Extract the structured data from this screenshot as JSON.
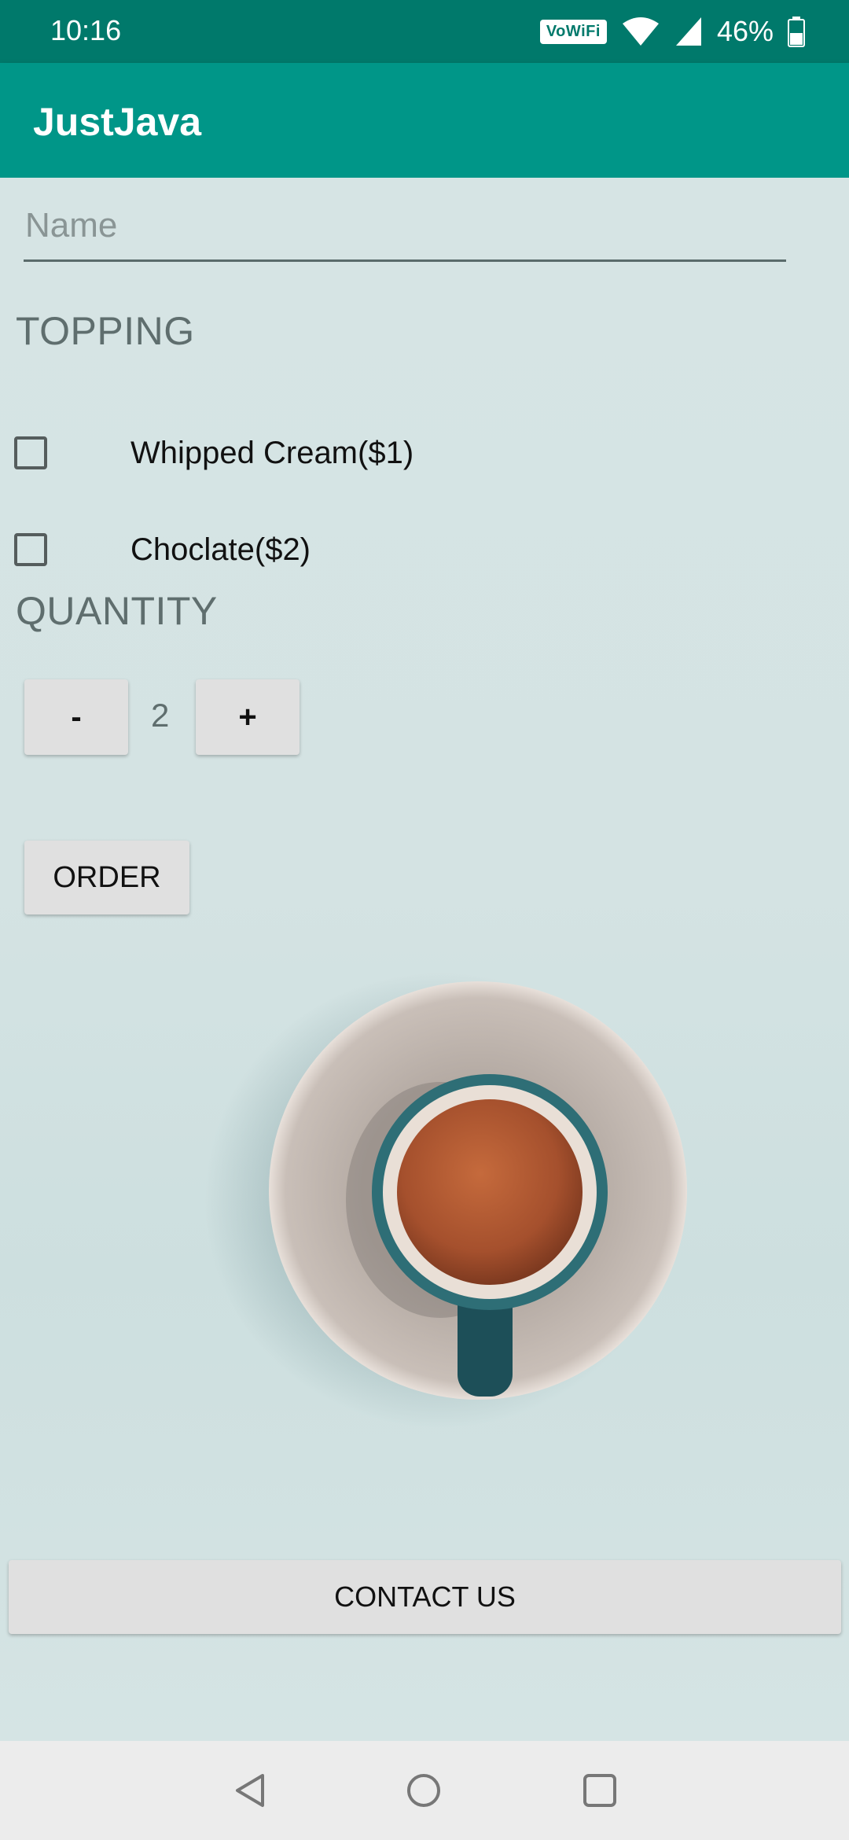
{
  "status_bar": {
    "time": "10:16",
    "vowifi": "VoWiFi",
    "battery": "46%"
  },
  "app_bar": {
    "title": "JustJava"
  },
  "form": {
    "name_placeholder": "Name",
    "name_value": "",
    "topping_label": "TOPPING",
    "toppings": [
      {
        "label": "Whipped Cream($1)",
        "checked": false
      },
      {
        "label": "Choclate($2)",
        "checked": false
      }
    ],
    "quantity_label": "QUANTITY",
    "decrement_label": "-",
    "quantity": "2",
    "increment_label": "+",
    "order_label": "ORDER",
    "contact_label": "CONTACT US"
  },
  "colors": {
    "status_bar": "#00796b",
    "app_bar": "#009688",
    "background": "#d6e4e4",
    "button": "#e0e0e0"
  },
  "icons": {
    "status": [
      "vowifi-badge",
      "wifi-icon",
      "signal-icon",
      "battery-icon"
    ],
    "nav": [
      "back-icon",
      "home-icon",
      "recents-icon"
    ]
  }
}
